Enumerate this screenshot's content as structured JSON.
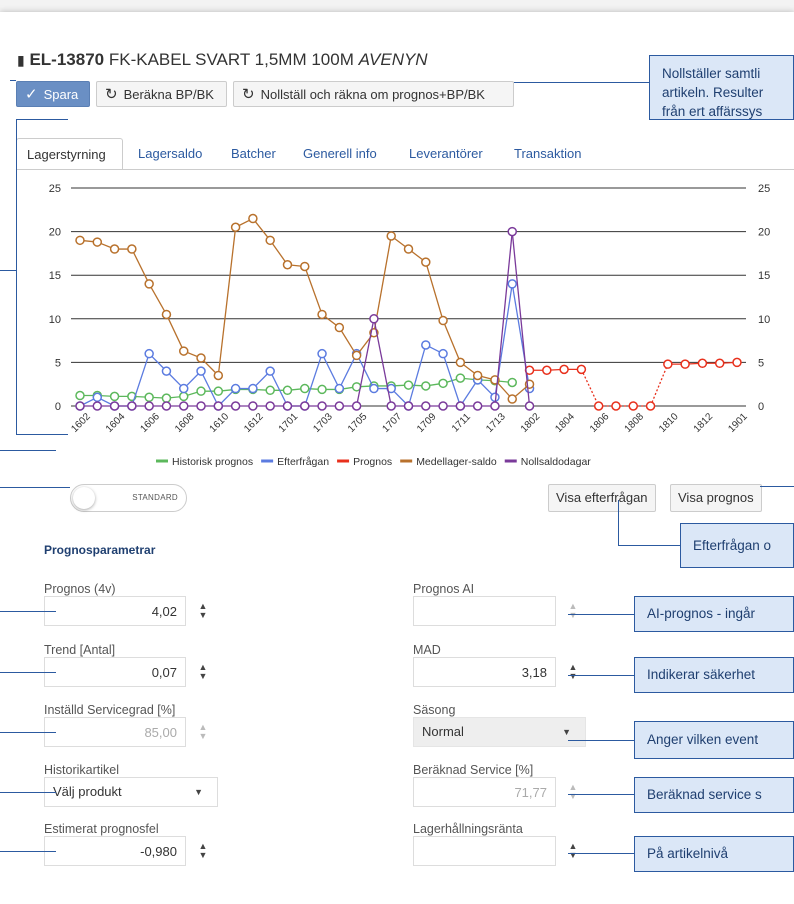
{
  "header": {
    "icon": "article-icon",
    "code": "EL-13870",
    "name": "FK-KABEL SVART 1,5MM 100M",
    "brand": "AVENYN"
  },
  "toolbar": {
    "save": "Spara",
    "calc": "Beräkna BP/BK",
    "reset": "Nollställ och räkna om prognos+BP/BK"
  },
  "tabs": [
    "Lagerstyrning",
    "Lagersaldo",
    "Batcher",
    "Generell info",
    "Leverantörer",
    "Transaktion"
  ],
  "callouts": {
    "top": [
      "Nollställer samtli",
      "artikeln. Resulter",
      "från ert affärssys"
    ],
    "demand": "Efterfrågan o",
    "ai": "AI-prognos - ingår",
    "mad": "Indikerar säkerhet",
    "season": "Anger vilken event",
    "service": "Beräknad service s",
    "interest": "På artikelnivå"
  },
  "toggle_label": "STANDARD",
  "buttons": {
    "show_demand": "Visa efterfrågan",
    "show_forecast": "Visa prognos"
  },
  "params": {
    "section_title": "Prognosparametrar",
    "forecast_label": "Prognos (4v)",
    "forecast_value": "4,02",
    "trend_label": "Trend [Antal]",
    "trend_value": "0,07",
    "service_label": "Inställd Servicegrad [%]",
    "service_value": "85,00",
    "history_label": "Historikartikel",
    "history_value": "Välj produkt",
    "error_label": "Estimerat prognosfel",
    "error_value": "-0,980",
    "ai_label": "Prognos AI",
    "ai_value": "",
    "mad_label": "MAD",
    "mad_value": "3,18",
    "season_label": "Säsong",
    "season_value": "Normal",
    "calc_service_label": "Beräknad Service [%]",
    "calc_service_value": "71,77",
    "interest_label": "Lagerhållningsränta",
    "interest_value": ""
  },
  "chart_data": {
    "type": "line",
    "x": [
      "1602",
      "1603",
      "1604",
      "1605",
      "1606",
      "1607",
      "1608",
      "1609",
      "1610",
      "1611",
      "1612",
      "1613",
      "1701",
      "1702",
      "1703",
      "1704",
      "1705",
      "1706",
      "1707",
      "1708",
      "1709",
      "1710",
      "1711",
      "1712",
      "1713",
      "1801",
      "1802",
      "1803",
      "1804",
      "1805",
      "1806",
      "1807",
      "1808",
      "1809",
      "1810",
      "1811",
      "1812",
      "1813",
      "1901"
    ],
    "x_tick_labels": [
      "1602",
      "1604",
      "1606",
      "1608",
      "1610",
      "1612",
      "1701",
      "1703",
      "1705",
      "1707",
      "1709",
      "1711",
      "1713",
      "1802",
      "1804",
      "1806",
      "1808",
      "1810",
      "1812",
      "1901"
    ],
    "ylim": [
      0,
      25
    ],
    "y_ticks": [
      0,
      5,
      10,
      15,
      20,
      25
    ],
    "series": [
      {
        "name": "Historisk prognos",
        "color": "#5cb85c",
        "values": [
          1.2,
          1.2,
          1.1,
          1.1,
          1.0,
          0.9,
          1.1,
          1.7,
          1.7,
          1.9,
          1.9,
          1.8,
          1.8,
          2.0,
          1.9,
          1.9,
          2.2,
          2.3,
          2.3,
          2.4,
          2.3,
          2.6,
          3.2,
          3.0,
          2.9,
          2.7,
          null,
          null,
          null,
          null,
          null,
          null,
          null,
          null,
          null,
          null,
          null,
          null,
          null
        ]
      },
      {
        "name": "Efterfrågan",
        "color": "#5b7be0",
        "values": [
          0,
          1,
          0,
          0,
          6,
          4,
          2,
          4,
          0,
          2,
          2,
          4,
          0,
          0,
          6,
          2,
          6,
          2,
          2,
          0,
          7,
          6,
          0,
          3,
          1,
          14,
          2,
          null,
          null,
          null,
          null,
          null,
          null,
          null,
          null,
          null,
          null,
          null,
          null
        ]
      },
      {
        "name": "Prognos",
        "color": "#e8301c",
        "values": [
          null,
          null,
          null,
          null,
          null,
          null,
          null,
          null,
          null,
          null,
          null,
          null,
          null,
          null,
          null,
          null,
          null,
          null,
          null,
          null,
          null,
          null,
          null,
          null,
          null,
          null,
          4.1,
          4.1,
          4.2,
          4.2,
          0,
          0,
          0,
          0,
          4.8,
          4.8,
          4.9,
          4.9,
          5.0
        ]
      },
      {
        "name": "Medellager-saldo",
        "color": "#b8712c",
        "values": [
          19,
          18.8,
          18,
          18,
          14,
          10.5,
          6.3,
          5.5,
          3.5,
          20.5,
          21.5,
          19,
          16.2,
          16,
          10.5,
          9,
          5.8,
          8.4,
          19.5,
          18,
          16.5,
          9.8,
          5,
          3.5,
          3,
          0.8,
          2.5,
          null,
          null,
          null,
          null,
          null,
          null,
          null,
          null,
          null,
          null,
          null,
          null
        ]
      },
      {
        "name": "Nollsaldodagar",
        "color": "#7a3a9a",
        "values": [
          0,
          0,
          0,
          0,
          0,
          0,
          0,
          0,
          0,
          0,
          0,
          0,
          0,
          0,
          0,
          0,
          0,
          10,
          0,
          0,
          0,
          0,
          0,
          0,
          0,
          20,
          0,
          null,
          null,
          null,
          null,
          null,
          null,
          null,
          null,
          null,
          null,
          null,
          null
        ]
      }
    ]
  }
}
